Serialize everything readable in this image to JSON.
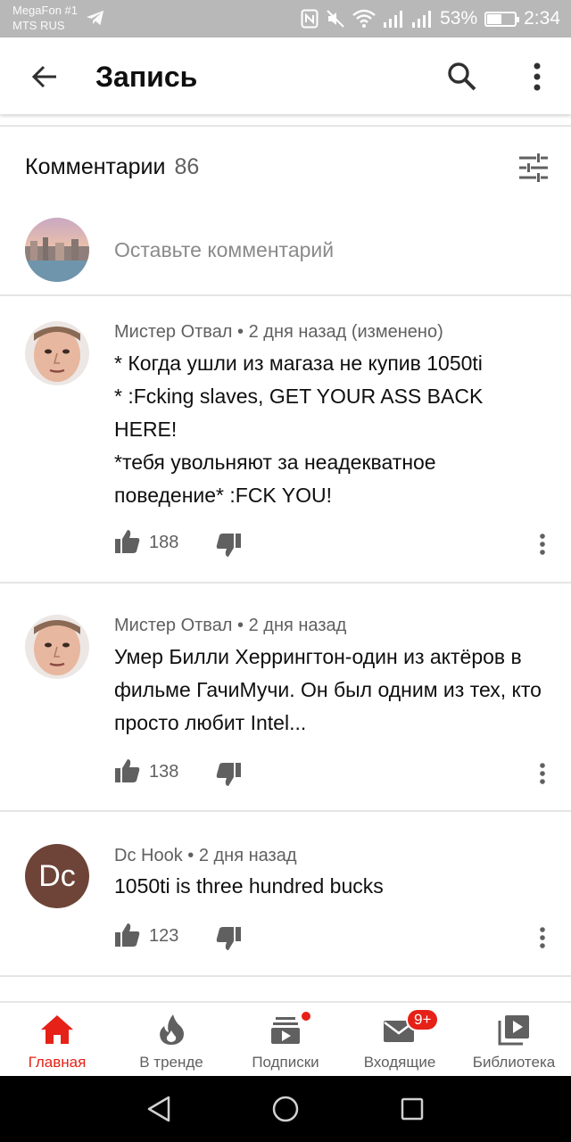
{
  "status_bar": {
    "carrier_line1": "MegaFon #1",
    "carrier_line2": "MTS RUS",
    "battery_percent": "53%",
    "battery_level": 0.53,
    "time": "2:34"
  },
  "app_bar": {
    "title": "Запись",
    "back_icon": "arrow-left-icon",
    "search_icon": "search-icon",
    "more_icon": "more-vert-icon"
  },
  "comments": {
    "header_label": "Комментарии",
    "count": "86",
    "sort_icon": "sort-sliders-icon",
    "add_placeholder": "Оставьте комментарий",
    "items": [
      {
        "author": "Мистер Отвал",
        "time": "2 дня назад (изменено)",
        "text": "* Когда ушли из магаза не купив 1050ti\n* :Fcking slaves, GET YOUR ASS BACK HERE!\n*тебя увольняют за неадекватное поведение* :FCK YOU!",
        "likes": "188"
      },
      {
        "author": "Мистер Отвал",
        "time": "2 дня назад",
        "text": "Умер Билли Херрингтон-один из актёров в фильме ГачиМучи. Он был одним из тех, кто просто любит Intel...",
        "likes": "138"
      },
      {
        "author": "Dc Hook",
        "avatar_letters": "Dc",
        "time": "2 дня назад",
        "text": "1050ti is three hundred bucks",
        "likes": "123"
      }
    ]
  },
  "bottom_nav": {
    "items": [
      {
        "label": "Главная",
        "icon": "home-icon",
        "active": true
      },
      {
        "label": "В тренде",
        "icon": "trending-flame-icon"
      },
      {
        "label": "Подписки",
        "icon": "subscriptions-icon"
      },
      {
        "label": "Входящие",
        "icon": "inbox-mail-icon",
        "badge": "9+"
      },
      {
        "label": "Библиотека",
        "icon": "library-icon"
      }
    ]
  },
  "colors": {
    "accent_red": "#e62117",
    "secondary_text": "#606060",
    "placeholder_text": "#8a8a8a",
    "status_bar_bg": "#b8b8b8",
    "avatar_dc_bg": "#6d4437"
  }
}
